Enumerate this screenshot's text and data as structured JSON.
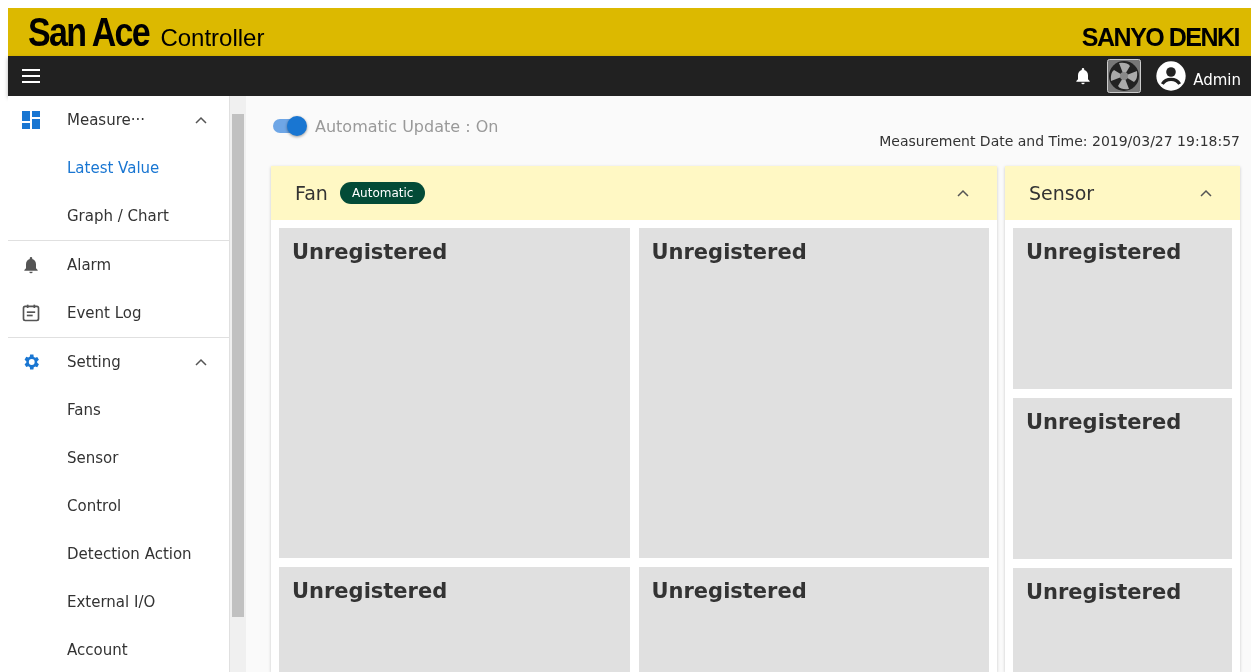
{
  "header": {
    "logo_main": "San Ace",
    "logo_sub": "Controller",
    "brand": "SANYO DENKI"
  },
  "toolbar": {
    "user": "Admin"
  },
  "sidebar": {
    "items": [
      {
        "label": "Measure···",
        "kind": "dashboard",
        "expanded": true,
        "divider_after": true,
        "children": [
          {
            "label": "Latest Value",
            "selected": true
          },
          {
            "label": "Graph / Chart",
            "selected": false
          }
        ]
      },
      {
        "label": "Alarm",
        "kind": "bell",
        "divider_after": false
      },
      {
        "label": "Event Log",
        "kind": "log",
        "divider_after": true
      },
      {
        "label": "Setting",
        "kind": "gear",
        "expanded": true,
        "divider_after": false,
        "children": [
          {
            "label": "Fans",
            "selected": false
          },
          {
            "label": "Sensor",
            "selected": false
          },
          {
            "label": "Control",
            "selected": false
          },
          {
            "label": "Detection Action",
            "selected": false
          },
          {
            "label": "External I/O",
            "selected": false
          },
          {
            "label": "Account",
            "selected": false
          }
        ]
      }
    ]
  },
  "auto_update": {
    "label": "Automatic Update : On",
    "on": true
  },
  "measurement_time": "Measurement Date and Time: 2019/03/27 19:18:57",
  "panels": [
    {
      "title": "Fan",
      "badge": "Automatic",
      "kind": "wide",
      "cards": [
        "Unregistered",
        "Unregistered",
        "Unregistered",
        "Unregistered"
      ]
    },
    {
      "title": "Sensor",
      "kind": "narrow",
      "cards": [
        "Unregistered",
        "Unregistered",
        "Unregistered"
      ]
    }
  ]
}
